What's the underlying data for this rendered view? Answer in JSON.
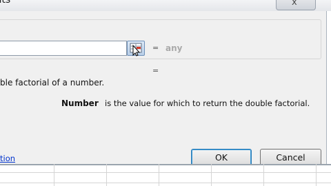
{
  "window": {
    "title": "nents",
    "close_label": "x"
  },
  "argument": {
    "equals": "=",
    "result": "any",
    "input_value": ""
  },
  "function_result": {
    "equals": "="
  },
  "function_description": "ble factorial of a number.",
  "argument_help": {
    "name": "Number",
    "description": "is the value for which to return the double factorial."
  },
  "footer": {
    "help_link": "tion",
    "ok_label": "OK",
    "cancel_label": "Cancel"
  },
  "icons": {
    "collapse": "range-select-icon",
    "close": "close-icon"
  },
  "colors": {
    "link": "#0033cc",
    "accent": "#3c9bd9",
    "dialog_bg": "#f0f0f0"
  }
}
